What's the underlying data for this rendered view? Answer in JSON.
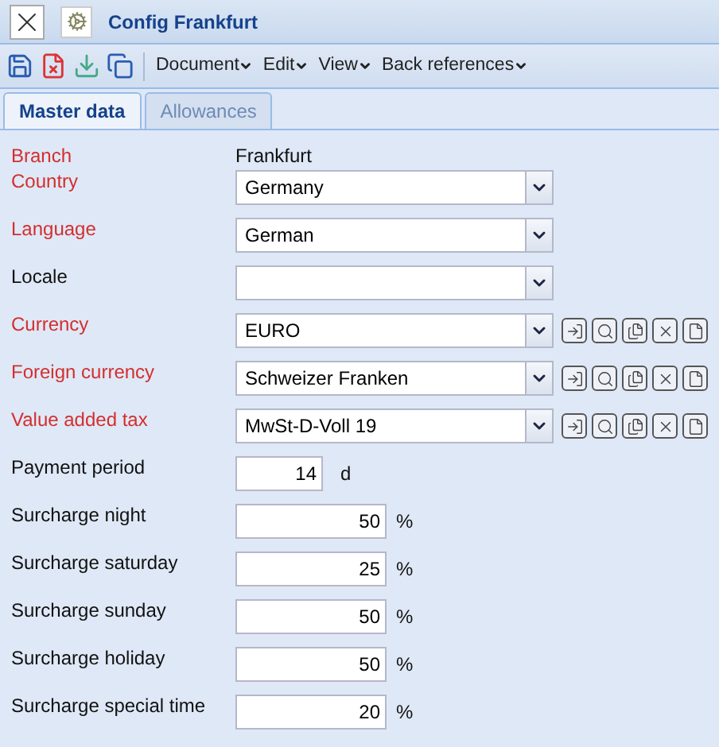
{
  "window": {
    "title": "Config Frankfurt"
  },
  "toolbar": {
    "menus": [
      "Document",
      "Edit",
      "View",
      "Back references"
    ]
  },
  "tabs": [
    {
      "label": "Master data",
      "selected": true
    },
    {
      "label": "Allowances",
      "selected": false
    }
  ],
  "fields": [
    {
      "kind": "text",
      "label": "Branch",
      "required": true,
      "value": "Frankfurt"
    },
    {
      "kind": "select",
      "label": "Country",
      "required": true,
      "value": "Germany",
      "actions": false
    },
    {
      "kind": "select",
      "label": "Language",
      "required": true,
      "value": "German",
      "actions": false
    },
    {
      "kind": "select",
      "label": "Locale",
      "required": false,
      "actions": false
    },
    {
      "kind": "select",
      "label": "Currency",
      "required": true,
      "value": "EURO",
      "actions": true
    },
    {
      "kind": "select",
      "label": "Foreign currency",
      "required": true,
      "value": "Schweizer Franken",
      "actions": true
    },
    {
      "kind": "select",
      "label": "Value added tax",
      "required": true,
      "value": "MwSt-D-Voll 19",
      "actions": true
    },
    {
      "kind": "period",
      "label": "Payment period",
      "required": false,
      "value": "14",
      "unit": "d"
    },
    {
      "kind": "number",
      "label": "Surcharge night",
      "required": false,
      "value": "50",
      "unit": "%"
    },
    {
      "kind": "number",
      "label": "Surcharge saturday",
      "required": false,
      "value": "25",
      "unit": "%"
    },
    {
      "kind": "number",
      "label": "Surcharge sunday",
      "required": false,
      "value": "50",
      "unit": "%"
    },
    {
      "kind": "number",
      "label": "Surcharge holiday",
      "required": false,
      "value": "50",
      "unit": "%"
    },
    {
      "kind": "number",
      "label": "Surcharge special time",
      "required": false,
      "value": "20",
      "unit": "%"
    }
  ]
}
